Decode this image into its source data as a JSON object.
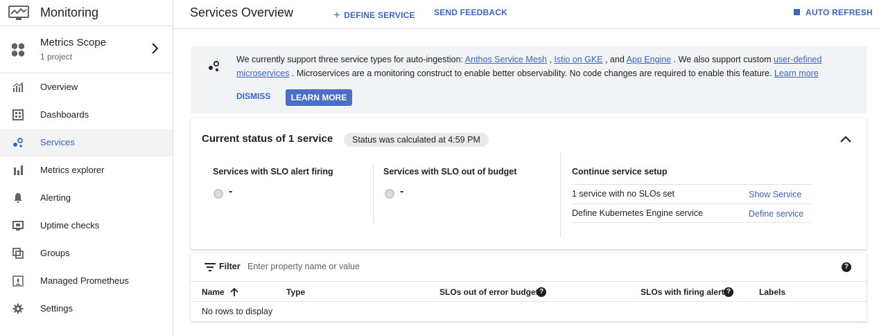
{
  "app": {
    "title": "Monitoring",
    "scope_title": "Metrics Scope",
    "scope_subtitle": "1 project"
  },
  "sidebar": {
    "items": [
      {
        "label": "Overview",
        "icon": "bar-chart-icon"
      },
      {
        "label": "Dashboards",
        "icon": "dashboard-icon"
      },
      {
        "label": "Services",
        "icon": "services-icon",
        "active": true
      },
      {
        "label": "Metrics explorer",
        "icon": "metrics-explorer-icon"
      },
      {
        "label": "Alerting",
        "icon": "bell-icon"
      },
      {
        "label": "Uptime checks",
        "icon": "monitor-icon"
      },
      {
        "label": "Groups",
        "icon": "groups-icon"
      },
      {
        "label": "Managed Prometheus",
        "icon": "prometheus-icon"
      },
      {
        "label": "Settings",
        "icon": "gear-icon"
      }
    ]
  },
  "header": {
    "title": "Services Overview",
    "define_service": "DEFINE SERVICE",
    "send_feedback": "SEND FEEDBACK",
    "auto_refresh": "AUTO REFRESH"
  },
  "banner": {
    "t1": "We currently support three service types for auto-ingestion: ",
    "link_asm": "Anthos Service Mesh",
    "t2": " , ",
    "link_istio": "Istio on GKE",
    "t3": " , and ",
    "link_appengine": "App Engine",
    "t4": " . We also support custom ",
    "link_udm": "user-defined microservices",
    "t5": " . Microservices are a monitoring construct to enable better observability. No code changes are required to enable this feature. ",
    "link_learn": "Learn more",
    "dismiss": "DISMISS",
    "learn_more": "LEARN MORE"
  },
  "status": {
    "title": "Current status of 1 service",
    "chip": "Status was calculated at 4:59 PM",
    "slo_alert_label": "Services with SLO alert firing",
    "slo_alert_value": "-",
    "slo_budget_label": "Services with SLO out of budget",
    "slo_budget_value": "-",
    "setup_title": "Continue service setup",
    "setup_rows": [
      {
        "text": "1 service with no SLOs set",
        "link": "Show Service"
      },
      {
        "text": "Define Kubernetes Engine service",
        "link": "Define service"
      }
    ]
  },
  "table": {
    "filter_label": "Filter",
    "filter_placeholder": "Enter property name or value",
    "help": "?",
    "columns": [
      "Name",
      "Type",
      "SLOs out of error budget",
      "SLOs with firing alert",
      "Labels"
    ],
    "empty_text": "No rows to display"
  },
  "colors": {
    "accent": "#3c64c8",
    "button_fill": "#4a6fc3",
    "banner_bg": "#f1f3f4"
  }
}
